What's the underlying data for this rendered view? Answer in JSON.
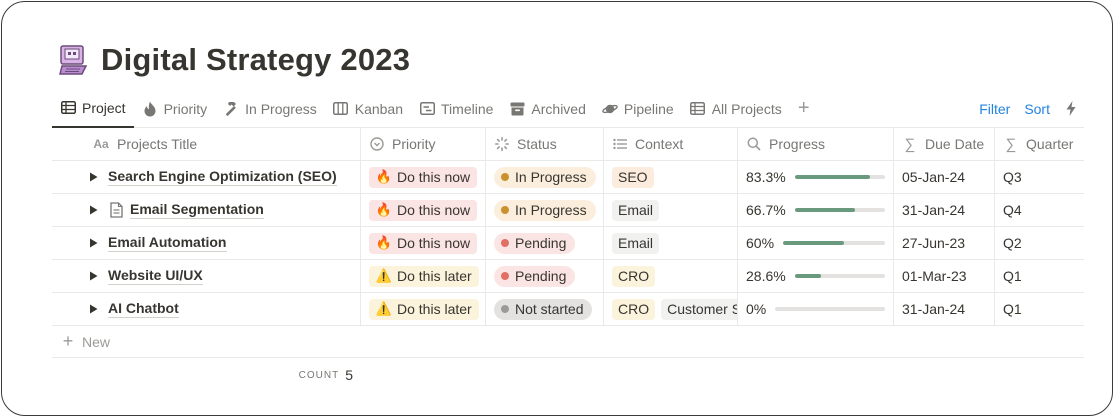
{
  "page": {
    "icon": "floppy-disk-computer-icon",
    "title": "Digital Strategy 2023"
  },
  "tabs": [
    {
      "label": "Project",
      "icon": "table-icon",
      "active": true
    },
    {
      "label": "Priority",
      "icon": "fire-icon",
      "active": false
    },
    {
      "label": "In Progress",
      "icon": "hammer-icon",
      "active": false
    },
    {
      "label": "Kanban",
      "icon": "board-icon",
      "active": false
    },
    {
      "label": "Timeline",
      "icon": "timeline-icon",
      "active": false
    },
    {
      "label": "Archived",
      "icon": "archive-box-icon",
      "active": false
    },
    {
      "label": "Pipeline",
      "icon": "planet-icon",
      "active": false
    },
    {
      "label": "All Projects",
      "icon": "table-icon",
      "active": false
    }
  ],
  "toolbar": {
    "filter_label": "Filter",
    "sort_label": "Sort"
  },
  "columns": {
    "title": "Projects Title",
    "priority": "Priority",
    "status": "Status",
    "context": "Context",
    "progress": "Progress",
    "due": "Due Date",
    "quarter": "Quarter"
  },
  "rows": [
    {
      "title": "Search Engine Optimization (SEO)",
      "has_doc": false,
      "priority": "Do this now",
      "status": "In Progress",
      "context": [
        "SEO"
      ],
      "progress_label": "83.3%",
      "progress": 0.833,
      "due": "05-Jan-24",
      "quarter": "Q3"
    },
    {
      "title": "Email Segmentation",
      "has_doc": true,
      "priority": "Do this now",
      "status": "In Progress",
      "context": [
        "Email"
      ],
      "progress_label": "66.7%",
      "progress": 0.667,
      "due": "31-Jan-24",
      "quarter": "Q4"
    },
    {
      "title": "Email Automation",
      "has_doc": false,
      "priority": "Do this now",
      "status": "Pending",
      "context": [
        "Email"
      ],
      "progress_label": "60%",
      "progress": 0.6,
      "due": "27-Jun-23",
      "quarter": "Q2"
    },
    {
      "title": "Website UI/UX",
      "has_doc": false,
      "priority": "Do this later",
      "status": "Pending",
      "context": [
        "CRO"
      ],
      "progress_label": "28.6%",
      "progress": 0.286,
      "due": "01-Mar-23",
      "quarter": "Q1"
    },
    {
      "title": "AI Chatbot",
      "has_doc": false,
      "priority": "Do this later",
      "status": "Not started",
      "context": [
        "CRO",
        "Customer S"
      ],
      "progress_label": "0%",
      "progress": 0,
      "due": "31-Jan-24",
      "quarter": "Q1"
    }
  ],
  "new_label": "New",
  "count": {
    "label": "COUNT",
    "value": "5"
  },
  "colors": {
    "accent": "#2383e2",
    "progress": "#6a9a7e",
    "priority_now_bg": "#fbe4e4",
    "priority_later_bg": "#fbf3db",
    "in_progress_dot": "#cb912f",
    "pending_dot": "#e16f64",
    "not_started_dot": "#9b9a97"
  }
}
